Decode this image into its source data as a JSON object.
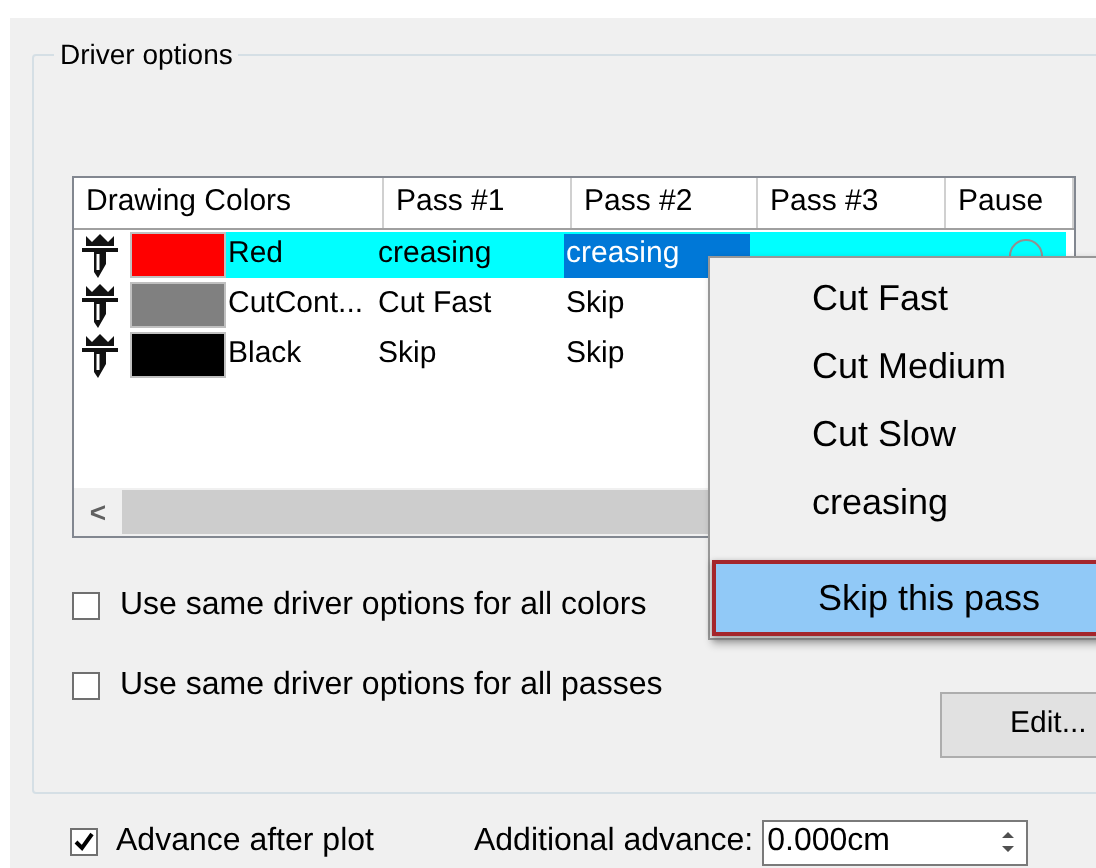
{
  "group": {
    "title": "Driver options"
  },
  "table": {
    "columns": [
      "Drawing Colors",
      "Pass #1",
      "Pass #2",
      "Pass #3",
      "Pause"
    ],
    "rows": [
      {
        "color": "#ff0000",
        "name": "Red",
        "pass_1": "creasing",
        "pass_2": "creasing",
        "selected": true,
        "pause_marker": true
      },
      {
        "color": "#808080",
        "name": "CutCont...",
        "pass_1": "Cut Fast",
        "pass_2": "Skip",
        "selected": false
      },
      {
        "color": "#000000",
        "name": "Black",
        "pass_1": "Skip",
        "pass_2": "Skip",
        "selected": false
      }
    ],
    "scroll_left": "<"
  },
  "context_menu": [
    {
      "label": "Cut Fast",
      "selected": false
    },
    {
      "label": "Cut Medium",
      "selected": false
    },
    {
      "label": "Cut Slow",
      "selected": false
    },
    {
      "label": "creasing",
      "selected": false
    },
    {
      "label": "Skip this pass",
      "selected": true
    }
  ],
  "options": [
    {
      "label": "Use same driver options for all colors",
      "checked": false
    },
    {
      "label": "Use same driver options for all passes",
      "checked": false
    }
  ],
  "edit_button": "Edit...",
  "advance": {
    "label": "Advance after plot",
    "checked": true
  },
  "additional_advance": {
    "label": "Additional advance:",
    "value": "0.000cm"
  }
}
